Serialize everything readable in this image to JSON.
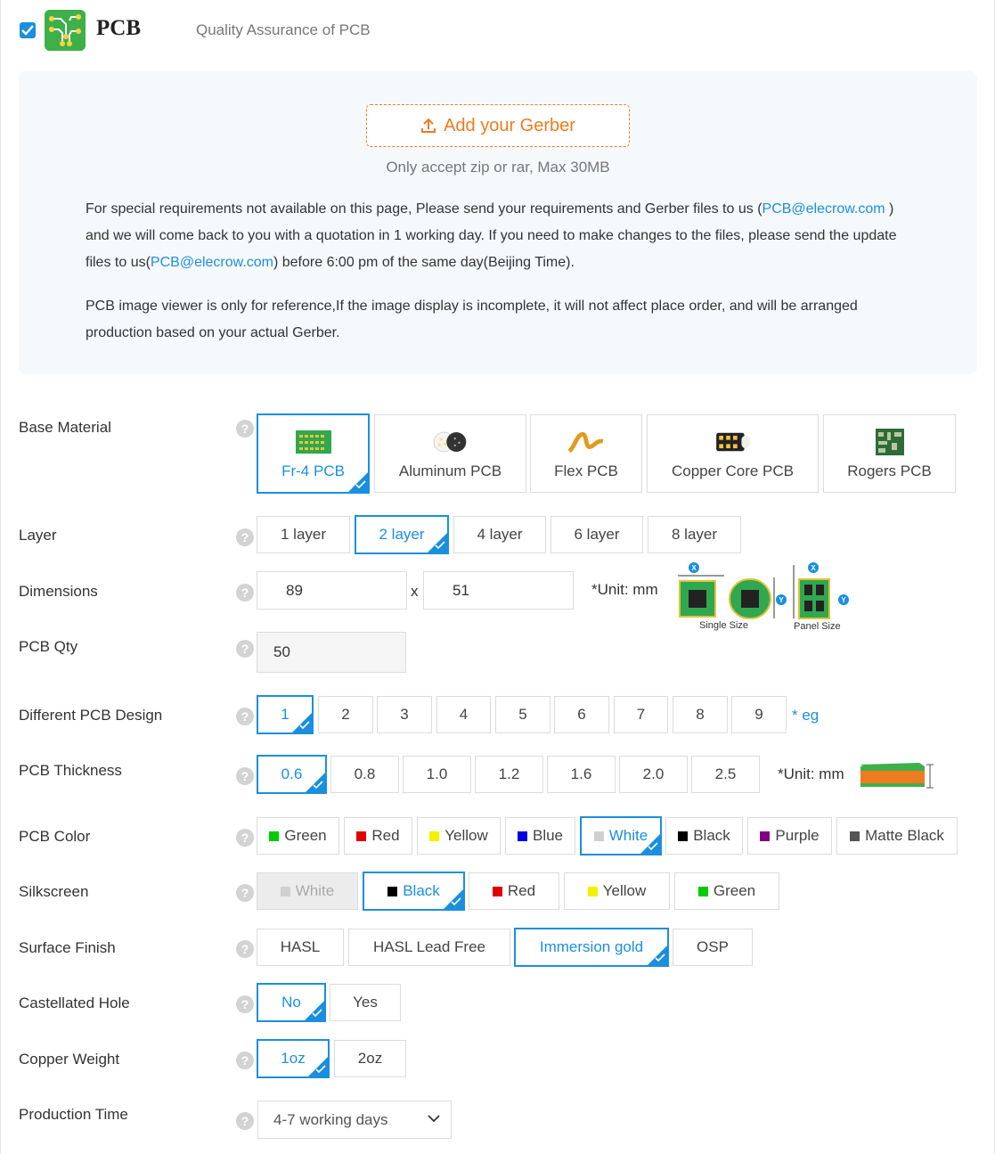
{
  "header": {
    "title": "PCB",
    "subtitle": "Quality Assurance of PCB"
  },
  "upload": {
    "button_label": "Add your Gerber",
    "note": "Only accept zip or rar, Max 30MB",
    "para1_a": "For special requirements not available on this page, Please send your requirements and Gerber files to us (",
    "email": "PCB@elecrow.com",
    "para1_b": " ) and we will come back to you with a quotation in 1 working day. If you need to make changes to the files, please send the update files to us(",
    "para1_c": ") before 6:00 pm of the same day(Beijing Time).",
    "para2": "PCB image viewer is only for reference,If the image display is incomplete, it will not affect place order, and will be arranged production based on your actual Gerber."
  },
  "base_material": {
    "label": "Base Material",
    "options": [
      "Fr-4 PCB",
      "Aluminum PCB",
      "Flex PCB",
      "Copper Core PCB",
      "Rogers PCB"
    ],
    "selected": "Fr-4 PCB"
  },
  "layer": {
    "label": "Layer",
    "options": [
      "1 layer",
      "2 layer",
      "4 layer",
      "6 layer",
      "8 layer"
    ],
    "selected": "2 layer"
  },
  "dimensions": {
    "label": "Dimensions",
    "x": "89",
    "sep": "x",
    "y": "51",
    "unit": "*Unit: mm",
    "single_caption": "Single Size",
    "panel_caption": "Panel Size"
  },
  "qty": {
    "label": "PCB Qty",
    "value": "50"
  },
  "design": {
    "label": "Different PCB Design",
    "options": [
      "1",
      "2",
      "3",
      "4",
      "5",
      "6",
      "7",
      "8",
      "9"
    ],
    "selected": "1",
    "eg": "* eg"
  },
  "thickness": {
    "label": "PCB Thickness",
    "options": [
      "0.6",
      "0.8",
      "1.0",
      "1.2",
      "1.6",
      "2.0",
      "2.5"
    ],
    "selected": "0.6",
    "unit": "*Unit: mm"
  },
  "pcb_color": {
    "label": "PCB Color",
    "options": [
      {
        "name": "Green",
        "color": "#00cc00"
      },
      {
        "name": "Red",
        "color": "#e00000"
      },
      {
        "name": "Yellow",
        "color": "#f5f000"
      },
      {
        "name": "Blue",
        "color": "#0000e0"
      },
      {
        "name": "White",
        "color": "#d0d0d0"
      },
      {
        "name": "Black",
        "color": "#000000"
      },
      {
        "name": "Purple",
        "color": "#800080"
      },
      {
        "name": "Matte Black",
        "color": "#555555"
      }
    ],
    "selected": "White"
  },
  "silkscreen": {
    "label": "Silkscreen",
    "options": [
      {
        "name": "White",
        "color": "#d0d0d0"
      },
      {
        "name": "Black",
        "color": "#000000"
      },
      {
        "name": "Red",
        "color": "#e00000"
      },
      {
        "name": "Yellow",
        "color": "#f5f000"
      },
      {
        "name": "Green",
        "color": "#00cc00"
      }
    ],
    "selected": "Black",
    "disabled": "White"
  },
  "surface": {
    "label": "Surface Finish",
    "options": [
      "HASL",
      "HASL Lead Free",
      "Immersion gold",
      "OSP"
    ],
    "selected": "Immersion gold"
  },
  "castellated": {
    "label": "Castellated Hole",
    "options": [
      "No",
      "Yes"
    ],
    "selected": "No"
  },
  "copper": {
    "label": "Copper Weight",
    "options": [
      "1oz",
      "2oz"
    ],
    "selected": "1oz"
  },
  "production": {
    "label": "Production Time",
    "value": "4-7 working days"
  },
  "accent": "#1a8fe0",
  "orange": "#f07a20"
}
